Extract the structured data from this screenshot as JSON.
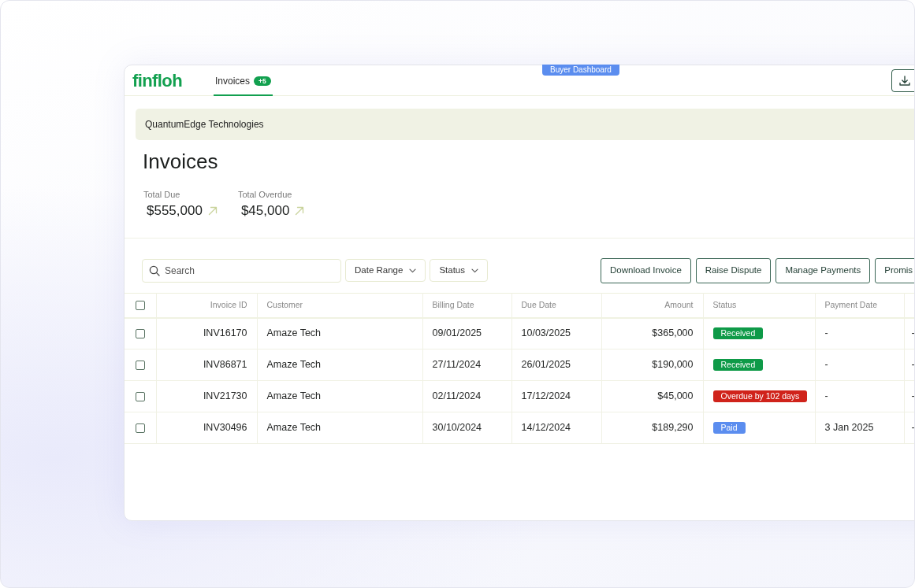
{
  "brand": {
    "logo": "finfloh"
  },
  "nav": {
    "tabs": [
      {
        "label": "Invoices",
        "badge": "+5",
        "selected": true
      }
    ]
  },
  "environment_tag": "Buyer Dashboard",
  "company_banner": "QuantumEdge Technologies",
  "page_title": "Invoices",
  "stats": [
    {
      "label": "Total Due",
      "value": "$555,000"
    },
    {
      "label": "Total Overdue",
      "value": "$45,000"
    }
  ],
  "toolbar": {
    "search": {
      "placeholder": "Search"
    },
    "filters": [
      {
        "label": "Date Range"
      },
      {
        "label": "Status"
      }
    ],
    "actions": [
      "Download Invoice",
      "Raise Dispute",
      "Manage Payments",
      "Promis"
    ]
  },
  "table": {
    "select_all": {
      "checked": false
    },
    "columns": [
      "Invoice ID",
      "Customer",
      "Billing Date",
      "Due Date",
      "Amount",
      "Status",
      "Payment Date"
    ],
    "rows": [
      {
        "checked": false,
        "cells": [
          "INV16170",
          "Amaze Tech",
          "09/01/2025",
          "10/03/2025",
          "$365,000",
          {
            "kind": "status",
            "label": "Received",
            "color": "#0e9a48"
          },
          "-",
          "-"
        ]
      },
      {
        "checked": false,
        "cells": [
          "INV86871",
          "Amaze Tech",
          "27/11/2024",
          "26/01/2025",
          "$190,000",
          {
            "kind": "status",
            "label": "Received",
            "color": "#0e9a48"
          },
          "-",
          "-"
        ]
      },
      {
        "checked": false,
        "cells": [
          "INV21730",
          "Amaze Tech",
          "02/11/2024",
          "17/12/2024",
          "$45,000",
          {
            "kind": "status",
            "label": "Overdue by 102 days",
            "color": "#d0231b"
          },
          "-",
          "-"
        ]
      },
      {
        "checked": false,
        "cells": [
          "INV30496",
          "Amaze Tech",
          "30/10/2024",
          "14/12/2024",
          "$189,290",
          {
            "kind": "status",
            "label": "Paid",
            "color": "#5b8def"
          },
          "3 Jan 2025",
          "-"
        ]
      }
    ]
  }
}
